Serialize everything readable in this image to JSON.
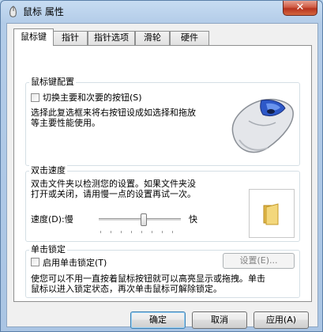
{
  "window": {
    "title": "鼠标 属性",
    "close_glyph": "✕"
  },
  "tabs": [
    {
      "label": "鼠标键",
      "active": true
    },
    {
      "label": "指针"
    },
    {
      "label": "指针选项"
    },
    {
      "label": "滑轮"
    },
    {
      "label": "硬件"
    }
  ],
  "buttons_config": {
    "title": "鼠标键配置",
    "checkbox_label": "切换主要和次要的按钮(S)",
    "checked": false,
    "description_line1": "选择此复选框来将右按钮设成如选择和拖放",
    "description_line2": "等主要性能使用。",
    "image_icon": "mouse-image"
  },
  "double_click": {
    "title": "双击速度",
    "description_line1": "双击文件夹以检测您的设置。如果文件夹没",
    "description_line2": "打开或关闭，请用慢一点的设置再试一次。",
    "speed_label": "速度(D):慢",
    "fast_label": "快",
    "speed_level": 0.55,
    "test_icon": "folder-icon"
  },
  "click_lock": {
    "title": "单击锁定",
    "checkbox_label": "启用单击锁定(T)",
    "checked": false,
    "settings_button": "设置(E)...",
    "description_line1": "使您可以不用一直按着鼠标按钮就可以高亮显示或拖拽。单击",
    "description_line2": "鼠标以进入锁定状态，再次单击鼠标可解除锁定。"
  },
  "dialog_buttons": {
    "ok": "确定",
    "cancel": "取消",
    "apply": "应用(A)"
  },
  "colors": {
    "accent": "#3c7fb1",
    "title_bar": "#b9d4ee",
    "close": "#c84a32"
  }
}
